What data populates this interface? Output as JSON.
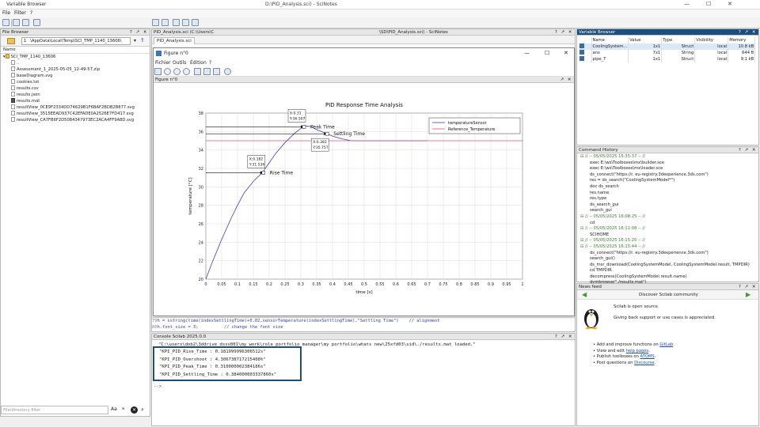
{
  "app": {
    "title": "Variable Browser",
    "window_title": "D:\\PID_Analysis.sci) - SciNotes"
  },
  "menu": [
    {
      "label": "File"
    },
    {
      "label": "Filter"
    },
    {
      "label": "?"
    }
  ],
  "file_browser": {
    "header": "File Browser",
    "path": "\\AppData\\Local\\Temp\\SCI_TMP_1140_13606\\",
    "column": "Name",
    "root": "SCI_TMP_1140_13606",
    "parent": "..",
    "items": [
      "Assessment_1_2025-05-05_12-49-57.zip",
      "baseDiagram.svg",
      "cookies.txt",
      "results.csv",
      "results.json",
      "results.mat",
      "resultView_0CE9F2334DD74629B1F6BAF2BDB2B877.svg",
      "resultView_3515EEAD937C42EFADE0A2526E7FD417.svg",
      "resultView_CA7FB6F2D5084347973EC2ACA4FF9A8D.svg"
    ],
    "filter_placeholder": "File/directory filter",
    "filter_btn_case": "Aa",
    "filter_btn_regex": "*"
  },
  "scinotes": {
    "header": "PID_Analysis.sci (C:\\Users\\C",
    "header_right": "\\SD\\PID_Analysis.sci) - SciNotes",
    "tab": "PID_Analysis.sci",
    "code_lines": [
      {
        "num": "79",
        "text": "h = xstring(time(indexSettlingTime)+0.02,sensorTemperature(indexSettlingTime),\"Settling Time\")    // alignment"
      },
      {
        "num": "80",
        "text": "h.font_size = 3;          // change the font size"
      }
    ]
  },
  "figure": {
    "title": "Figure n°0",
    "menu": [
      "Fichier",
      "Outils",
      "Édition",
      "?"
    ],
    "inner_header": "Figure n°0",
    "win_min": "—",
    "win_max": "☐",
    "win_close": "✕"
  },
  "chart_data": {
    "type": "line",
    "title": "PID Response Time Analysis",
    "xlabel": "time [s]",
    "ylabel": "temperature [°C]",
    "xlim": [
      0,
      1
    ],
    "ylim": [
      20,
      38
    ],
    "xticks": [
      "0",
      "0.05",
      "0.1",
      "0.15",
      "0.2",
      "0.25",
      "0.3",
      "0.35",
      "0.4",
      "0.45",
      "0.5",
      "0.55",
      "0.6",
      "0.65",
      "0.7",
      "0.75",
      "0.8",
      "0.85",
      "0.9",
      "0.95",
      "1"
    ],
    "yticks": [
      "20",
      "22",
      "24",
      "26",
      "28",
      "30",
      "32",
      "34",
      "36",
      "38"
    ],
    "grid": true,
    "legend_position": "top-right",
    "series": [
      {
        "name": "temperatureSensor",
        "color": "#4a3bb0",
        "x": [
          0,
          0.02,
          0.05,
          0.08,
          0.1,
          0.12,
          0.15,
          0.18,
          0.2,
          0.22,
          0.25,
          0.28,
          0.31,
          0.33,
          0.35,
          0.38,
          0.4,
          0.43,
          0.46,
          0.5,
          0.55,
          0.6,
          0.65,
          0.7
        ],
        "y": [
          20,
          21.8,
          24.3,
          26.6,
          28,
          29.3,
          30.6,
          31.6,
          32.6,
          33.6,
          34.8,
          35.8,
          36.6,
          36.55,
          36.2,
          35.8,
          35.5,
          35.2,
          35,
          35,
          35,
          35,
          35,
          35
        ]
      },
      {
        "name": "Reference_Temperature",
        "color": "#e05070",
        "x": [
          0,
          1
        ],
        "y": [
          35,
          35
        ]
      }
    ],
    "annotations": [
      {
        "label": "Rise Time",
        "x": 0.182,
        "y": 31.536,
        "tip_x": "X:0.182",
        "tip_y": "Y:31.536"
      },
      {
        "label": "Peak Time",
        "x": 0.31,
        "y": 36.507,
        "tip_x": "X:0.31",
        "tip_y": "Y:36.507"
      },
      {
        "label": "Settling Time",
        "x": 0.383,
        "y": 35.757,
        "tip_x": "X:0.383",
        "tip_y": "Y:35.757"
      }
    ]
  },
  "console": {
    "header": "Console Scilab 2025.0.0",
    "load_line": "\"C:\\users\\dob2\\3ddrive_dssx001\\my_work\\role portfolio manager\\my portfolio\\whats new\\25xfd03\\sid\\./results.mat loaded.\"",
    "kpis": [
      "\"KPI_PID_Rise_Time : 0.181999996306512s\"",
      "\"KPI_PID_Overshoot : 4.306738717215408%\"",
      "\"KPI_PID_Peak_Time : 0.310000002384186s\"",
      "\"KPI_PID_Settling_Time : 0.384000003337860s\""
    ],
    "prompt": "-->"
  },
  "variable_browser": {
    "header": "Variable Browser",
    "columns": [
      "Name",
      "Value",
      "Type",
      "Visibility",
      "Memory"
    ],
    "rows": [
      {
        "name": "CoolingSystem...",
        "value": "1x1",
        "type": "Struct",
        "visibility": "local",
        "memory": "10.8 kB"
      },
      {
        "name": "ans",
        "value": "7x1",
        "type": "String",
        "visibility": "local",
        "memory": "644 B"
      },
      {
        "name": "pipe_T",
        "value": "1x1",
        "type": "Struct",
        "visibility": "local",
        "memory": "9.1 kB"
      }
    ]
  },
  "command_history": {
    "header": "Command History",
    "lines": [
      {
        "text": "// -- 05/05/2025 15:35:37 -- //",
        "date": true
      },
      {
        "text": "exec E:\\ws\\Toolboxes\\mx\\builder.sce",
        "date": false
      },
      {
        "text": "exec E:\\ws\\Toolboxes\\mx\\loader.sce",
        "date": false
      },
      {
        "text": "ds_connect(\"https://r.          eu-registry.3dexperience.3ds.com\")",
        "date": false
      },
      {
        "text": "res = ds_search(\"CoolingSystemModel*\")",
        "date": false
      },
      {
        "text": "doc ds_search",
        "date": false
      },
      {
        "text": "res.name",
        "date": false
      },
      {
        "text": "res.type",
        "date": false
      },
      {
        "text": "ds_search_gui",
        "date": false
      },
      {
        "text": "search_gui",
        "date": false
      },
      {
        "text": "// -- 05/05/2025 16:08:25 -- //",
        "date": true
      },
      {
        "text": "cd",
        "date": false
      },
      {
        "text": "// -- 05/05/2025 16:11:08 -- //",
        "date": true
      },
      {
        "text": "SCIHOME",
        "date": false
      },
      {
        "text": "// -- 05/05/2025 16:15:20 -- //",
        "date": true
      },
      {
        "text": "// -- 05/05/2025 16:15:44 -- //",
        "date": true
      },
      {
        "text": "ds_connect(\"https://r.          eu-registry.3dexperience.3ds.com\")",
        "date": false
      },
      {
        "text": "search_gui()",
        "date": false
      },
      {
        "text": "ds_msr_download(CoolingSystemModel, CoolingSystemModel.result, TMPDIR)",
        "date": false
      },
      {
        "text": "cd TMPDIR",
        "date": false
      },
      {
        "text": "decompress(CoolingSystemModel.result.name)",
        "date": false
      },
      {
        "text": "dymbrowse(\"./results.mat\")",
        "date": false
      }
    ]
  },
  "news_feed": {
    "header": "News feed",
    "nav_title": "Discover Scilab community",
    "text1": "Scilab is open source.",
    "text2": "Giving back support or use cases is appreciated.",
    "items": [
      {
        "prefix": "• Add and improve functions on ",
        "link": "GitLab",
        "suffix": "."
      },
      {
        "prefix": "• View and edit ",
        "link": "help pages",
        "suffix": "."
      },
      {
        "prefix": "• Publish toolboxes on ",
        "link": "ATOMS",
        "suffix": "."
      },
      {
        "prefix": "• Post questions on ",
        "link": "Discourse",
        "suffix": "."
      }
    ]
  },
  "colors": {
    "accent": "#1a4e7c",
    "kpi_border": "#1a4e7c",
    "history_date": "#3a7d2d"
  }
}
